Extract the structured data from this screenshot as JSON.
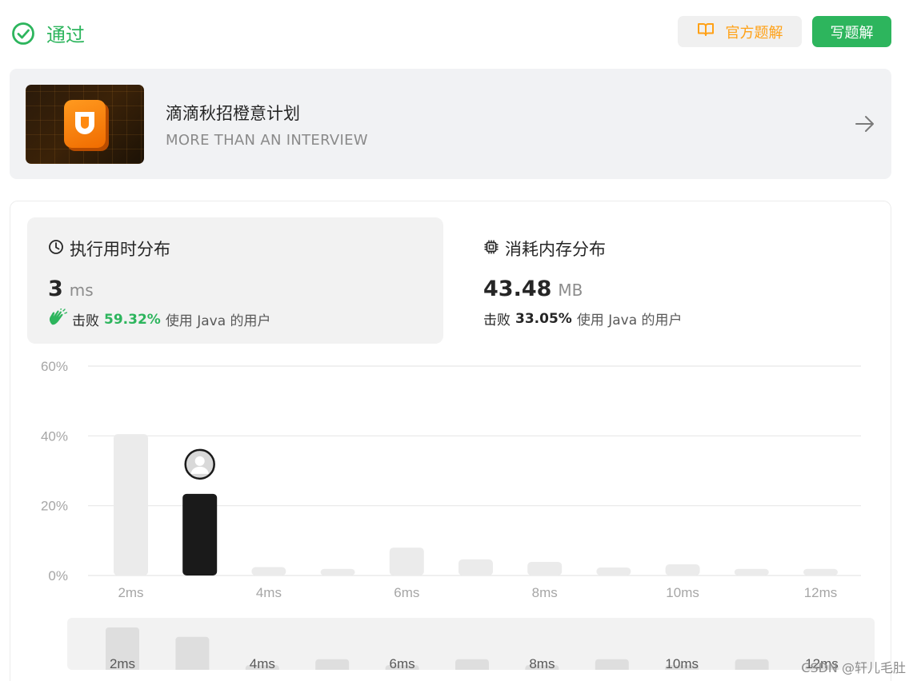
{
  "header": {
    "status": "通过",
    "official_btn": "官方题解",
    "write_btn": "写题解"
  },
  "banner": {
    "title": "滴滴秋招橙意计划",
    "subtitle": "MORE THAN AN INTERVIEW"
  },
  "runtime": {
    "title": "执行用时分布",
    "value": "3",
    "unit": "ms",
    "beat_label": "击败",
    "beat_pct": "59.32%",
    "beat_tail": "使用 Java 的用户"
  },
  "memory": {
    "title": "消耗内存分布",
    "value": "43.48",
    "unit": "MB",
    "beat_label": "击败",
    "beat_pct": "33.05%",
    "beat_tail": "使用 Java 的用户"
  },
  "colors": {
    "accent_green": "#2db55d",
    "accent_orange": "#ffa116",
    "bar_default": "#ebebeb",
    "bar_active": "#1a1a1a"
  },
  "chart_data": {
    "type": "bar",
    "x": [
      2,
      3,
      4,
      5,
      6,
      7,
      8,
      9,
      10,
      11,
      12
    ],
    "values": [
      40.5,
      23.4,
      2.4,
      1.9,
      8.0,
      4.6,
      3.9,
      2.3,
      3.2,
      1.9,
      1.9
    ],
    "highlight_index": 1,
    "x_tick_labels": [
      "2ms",
      "4ms",
      "6ms",
      "8ms",
      "10ms",
      "12ms"
    ],
    "y_tick_labels": [
      "60%",
      "40%",
      "20%",
      "0%"
    ],
    "ylim": [
      0,
      60
    ],
    "grid": true,
    "mini_values": [
      36,
      28,
      4,
      9,
      4,
      9,
      4,
      9,
      4,
      9,
      4
    ],
    "mini_tick_labels": [
      "2ms",
      "4ms",
      "6ms",
      "8ms",
      "10ms",
      "12ms"
    ]
  },
  "watermark": "CSDN @轩儿毛肚"
}
